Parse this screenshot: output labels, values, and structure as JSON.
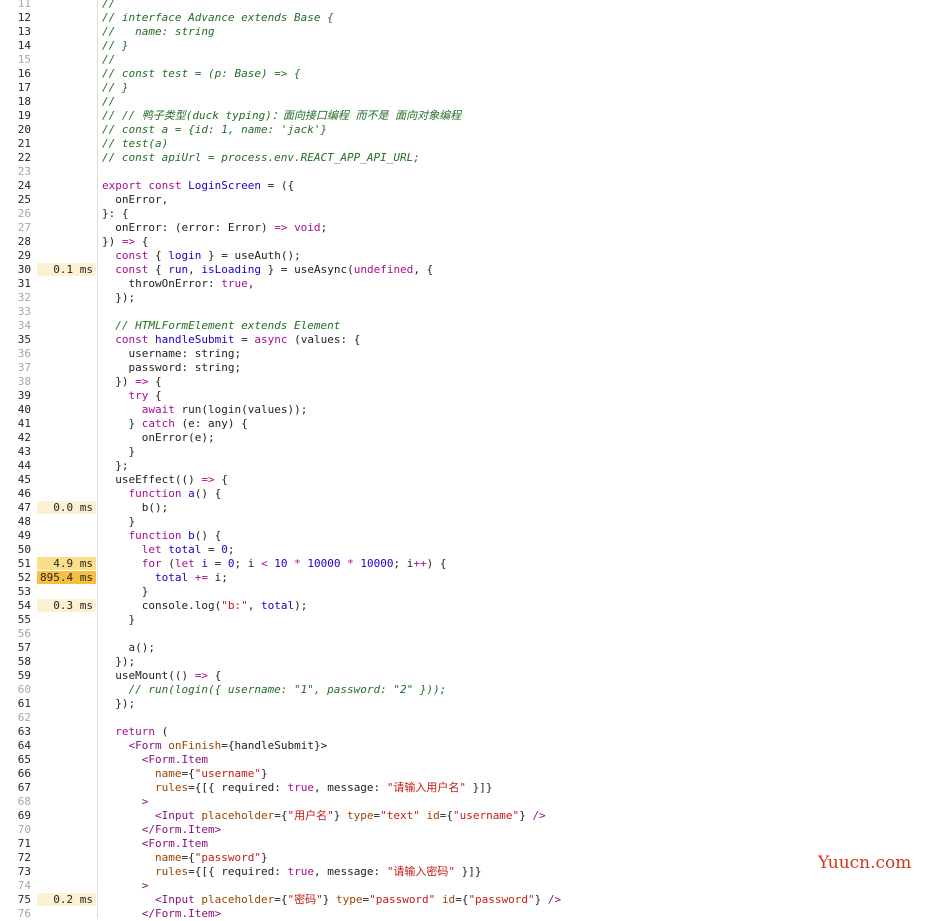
{
  "colors": {
    "heat_low": "#fdf1d4",
    "heat_mid": "#fcdd8c",
    "heat_high": "#f7bf3f",
    "gutter_line": "#dcdcdc"
  },
  "watermark": "Yuucn.com",
  "lines": [
    {
      "n": "11",
      "dim": true,
      "t": "",
      "tok": [
        [
          "//",
          "c"
        ]
      ]
    },
    {
      "n": "12",
      "t": "",
      "tok": [
        [
          "// interface Advance extends Base {",
          "c"
        ]
      ]
    },
    {
      "n": "13",
      "t": "",
      "tok": [
        [
          "//   name: string",
          "c"
        ]
      ]
    },
    {
      "n": "14",
      "t": "",
      "tok": [
        [
          "// }",
          "c"
        ]
      ]
    },
    {
      "n": "15",
      "dim": true,
      "t": "",
      "tok": [
        [
          "//",
          "c"
        ]
      ]
    },
    {
      "n": "16",
      "t": "",
      "tok": [
        [
          "// const test = (p: Base) => {",
          "c"
        ]
      ]
    },
    {
      "n": "17",
      "t": "",
      "tok": [
        [
          "// }",
          "c"
        ]
      ]
    },
    {
      "n": "18",
      "t": "",
      "tok": [
        [
          "//",
          "c"
        ]
      ]
    },
    {
      "n": "19",
      "t": "",
      "tok": [
        [
          "// // 鸭子类型(duck typing)：面向接口编程 而不是 面向对象编程",
          "c"
        ]
      ]
    },
    {
      "n": "20",
      "t": "",
      "tok": [
        [
          "// const a = {id: 1, name: 'jack'}",
          "c"
        ]
      ]
    },
    {
      "n": "21",
      "t": "",
      "tok": [
        [
          "// test(a)",
          "c"
        ]
      ]
    },
    {
      "n": "22",
      "t": "",
      "tok": [
        [
          "// const apiUrl = process.env.REACT_APP_API_URL;",
          "c"
        ]
      ]
    },
    {
      "n": "23",
      "dim": true,
      "t": "",
      "tok": []
    },
    {
      "n": "24",
      "t": "",
      "tok": [
        [
          "export const ",
          "k"
        ],
        [
          "LoginScreen",
          "f"
        ],
        [
          " = ({",
          "d"
        ]
      ]
    },
    {
      "n": "25",
      "t": "",
      "tok": [
        [
          "  onError,",
          "d"
        ]
      ]
    },
    {
      "n": "26",
      "dim": true,
      "t": "",
      "tok": [
        [
          "}: {",
          "d"
        ]
      ]
    },
    {
      "n": "27",
      "dim": true,
      "t": "",
      "tok": [
        [
          "  onError: (error: Error) ",
          "d"
        ],
        [
          "=>",
          "k"
        ],
        [
          " ",
          "d"
        ],
        [
          "void",
          "k"
        ],
        [
          ";",
          "d"
        ]
      ]
    },
    {
      "n": "28",
      "t": "",
      "tok": [
        [
          "}) ",
          "d"
        ],
        [
          "=>",
          "k"
        ],
        [
          " {",
          "d"
        ]
      ]
    },
    {
      "n": "29",
      "t": "",
      "tok": [
        [
          "  ",
          "d"
        ],
        [
          "const",
          "k"
        ],
        [
          " { ",
          "d"
        ],
        [
          "login",
          "f"
        ],
        [
          " } = useAuth();",
          "d"
        ]
      ]
    },
    {
      "n": "30",
      "t": "0.1ms",
      "h": "low",
      "tok": [
        [
          "  ",
          "d"
        ],
        [
          "const",
          "k"
        ],
        [
          " { ",
          "d"
        ],
        [
          "run",
          "f"
        ],
        [
          ", ",
          "d"
        ],
        [
          "isLoading",
          "f"
        ],
        [
          " } = useAsync(",
          "d"
        ],
        [
          "undefined",
          "k"
        ],
        [
          ", {",
          "d"
        ]
      ]
    },
    {
      "n": "31",
      "t": "",
      "tok": [
        [
          "    throwOnError: ",
          "d"
        ],
        [
          "true",
          "k"
        ],
        [
          ",",
          "d"
        ]
      ]
    },
    {
      "n": "32",
      "dim": true,
      "t": "",
      "tok": [
        [
          "  });",
          "d"
        ]
      ]
    },
    {
      "n": "33",
      "dim": true,
      "t": "",
      "tok": []
    },
    {
      "n": "34",
      "dim": true,
      "t": "",
      "tok": [
        [
          "  // HTMLFormElement extends Element",
          "c"
        ]
      ]
    },
    {
      "n": "35",
      "t": "",
      "tok": [
        [
          "  ",
          "d"
        ],
        [
          "const",
          "k"
        ],
        [
          " ",
          "d"
        ],
        [
          "handleSubmit",
          "f"
        ],
        [
          " = ",
          "d"
        ],
        [
          "async",
          "k"
        ],
        [
          " (values: {",
          "d"
        ]
      ]
    },
    {
      "n": "36",
      "dim": true,
      "t": "",
      "tok": [
        [
          "    username: string;",
          "d"
        ]
      ]
    },
    {
      "n": "37",
      "dim": true,
      "t": "",
      "tok": [
        [
          "    password: string;",
          "d"
        ]
      ]
    },
    {
      "n": "38",
      "dim": true,
      "t": "",
      "tok": [
        [
          "  }) ",
          "d"
        ],
        [
          "=>",
          "k"
        ],
        [
          " {",
          "d"
        ]
      ]
    },
    {
      "n": "39",
      "t": "",
      "tok": [
        [
          "    ",
          "d"
        ],
        [
          "try",
          "k"
        ],
        [
          " {",
          "d"
        ]
      ]
    },
    {
      "n": "40",
      "t": "",
      "tok": [
        [
          "      ",
          "d"
        ],
        [
          "await",
          "k"
        ],
        [
          " run(login(values));",
          "d"
        ]
      ]
    },
    {
      "n": "41",
      "t": "",
      "tok": [
        [
          "    } ",
          "d"
        ],
        [
          "catch",
          "k"
        ],
        [
          " (e: any) {",
          "d"
        ]
      ]
    },
    {
      "n": "42",
      "t": "",
      "tok": [
        [
          "      onError(e);",
          "d"
        ]
      ]
    },
    {
      "n": "43",
      "t": "",
      "tok": [
        [
          "    }",
          "d"
        ]
      ]
    },
    {
      "n": "44",
      "t": "",
      "tok": [
        [
          "  };",
          "d"
        ]
      ]
    },
    {
      "n": "45",
      "t": "",
      "tok": [
        [
          "  useEffect(() ",
          "d"
        ],
        [
          "=>",
          "k"
        ],
        [
          " {",
          "d"
        ]
      ]
    },
    {
      "n": "46",
      "t": "",
      "tok": [
        [
          "    ",
          "d"
        ],
        [
          "function",
          "k"
        ],
        [
          " ",
          "d"
        ],
        [
          "a",
          "f"
        ],
        [
          "() {",
          "d"
        ]
      ]
    },
    {
      "n": "47",
      "t": "0.0ms",
      "h": "low",
      "tok": [
        [
          "      b();",
          "d"
        ]
      ]
    },
    {
      "n": "48",
      "t": "",
      "tok": [
        [
          "    }",
          "d"
        ]
      ]
    },
    {
      "n": "49",
      "t": "",
      "tok": [
        [
          "    ",
          "d"
        ],
        [
          "function",
          "k"
        ],
        [
          " ",
          "d"
        ],
        [
          "b",
          "f"
        ],
        [
          "() {",
          "d"
        ]
      ]
    },
    {
      "n": "50",
      "t": "",
      "tok": [
        [
          "      ",
          "d"
        ],
        [
          "let",
          "k"
        ],
        [
          " ",
          "d"
        ],
        [
          "total",
          "f"
        ],
        [
          " = ",
          "d"
        ],
        [
          "0",
          "n"
        ],
        [
          ";",
          "d"
        ]
      ]
    },
    {
      "n": "51",
      "t": "4.9ms",
      "h": "mid",
      "tok": [
        [
          "      ",
          "d"
        ],
        [
          "for",
          "k"
        ],
        [
          " (",
          "d"
        ],
        [
          "let",
          "k"
        ],
        [
          " ",
          "d"
        ],
        [
          "i",
          "f"
        ],
        [
          " = ",
          "d"
        ],
        [
          "0",
          "n"
        ],
        [
          "; i ",
          "d"
        ],
        [
          "<",
          "k"
        ],
        [
          " ",
          "d"
        ],
        [
          "10",
          "n"
        ],
        [
          " ",
          "d"
        ],
        [
          "*",
          "k"
        ],
        [
          " ",
          "d"
        ],
        [
          "10000",
          "n"
        ],
        [
          " ",
          "d"
        ],
        [
          "*",
          "k"
        ],
        [
          " ",
          "d"
        ],
        [
          "10000",
          "n"
        ],
        [
          "; i",
          "d"
        ],
        [
          "++",
          "k"
        ],
        [
          ") {",
          "d"
        ]
      ]
    },
    {
      "n": "52",
      "t": "895.4ms",
      "h": "high",
      "tok": [
        [
          "        ",
          "d"
        ],
        [
          "total",
          "f"
        ],
        [
          " ",
          "d"
        ],
        [
          "+=",
          "k"
        ],
        [
          " i;",
          "d"
        ]
      ]
    },
    {
      "n": "53",
      "t": "",
      "tok": [
        [
          "      }",
          "d"
        ]
      ]
    },
    {
      "n": "54",
      "t": "0.3ms",
      "h": "low",
      "tok": [
        [
          "      console.log(",
          "d"
        ],
        [
          "\"b:\"",
          "s"
        ],
        [
          ", ",
          "d"
        ],
        [
          "total",
          "f"
        ],
        [
          ");",
          "d"
        ]
      ]
    },
    {
      "n": "55",
      "t": "",
      "tok": [
        [
          "    }",
          "d"
        ]
      ]
    },
    {
      "n": "56",
      "dim": true,
      "t": "",
      "tok": []
    },
    {
      "n": "57",
      "t": "",
      "tok": [
        [
          "    a();",
          "d"
        ]
      ]
    },
    {
      "n": "58",
      "t": "",
      "tok": [
        [
          "  });",
          "d"
        ]
      ]
    },
    {
      "n": "59",
      "t": "",
      "tok": [
        [
          "  useMount(() ",
          "d"
        ],
        [
          "=>",
          "k"
        ],
        [
          " {",
          "d"
        ]
      ]
    },
    {
      "n": "60",
      "dim": true,
      "t": "",
      "tok": [
        [
          "    // run(login({ username: \"1\", password: \"2\" }));",
          "c"
        ]
      ]
    },
    {
      "n": "61",
      "t": "",
      "tok": [
        [
          "  });",
          "d"
        ]
      ]
    },
    {
      "n": "62",
      "dim": true,
      "t": "",
      "tok": []
    },
    {
      "n": "63",
      "t": "",
      "tok": [
        [
          "  ",
          "d"
        ],
        [
          "return",
          "k"
        ],
        [
          " (",
          "d"
        ]
      ]
    },
    {
      "n": "64",
      "t": "",
      "tok": [
        [
          "    <",
          "t"
        ],
        [
          "Form",
          "t"
        ],
        [
          " ",
          "d"
        ],
        [
          "onFinish",
          "a"
        ],
        [
          "={handleSubmit}>",
          "d"
        ]
      ]
    },
    {
      "n": "65",
      "t": "",
      "tok": [
        [
          "      <Form.Item",
          "t"
        ]
      ]
    },
    {
      "n": "66",
      "t": "",
      "tok": [
        [
          "        ",
          "d"
        ],
        [
          "name",
          "a"
        ],
        [
          "={",
          "d"
        ],
        [
          "\"username\"",
          "s"
        ],
        [
          "}",
          "d"
        ]
      ]
    },
    {
      "n": "67",
      "t": "",
      "tok": [
        [
          "        ",
          "d"
        ],
        [
          "rules",
          "a"
        ],
        [
          "={[{ required: ",
          "d"
        ],
        [
          "true",
          "k"
        ],
        [
          ", message: ",
          "d"
        ],
        [
          "\"请输入用户名\"",
          "s"
        ],
        [
          " }]}",
          "d"
        ]
      ]
    },
    {
      "n": "68",
      "dim": true,
      "t": "",
      "tok": [
        [
          "      >",
          "t"
        ]
      ]
    },
    {
      "n": "69",
      "t": "",
      "tok": [
        [
          "        <Input ",
          "t"
        ],
        [
          "placeholder",
          "a"
        ],
        [
          "={",
          "d"
        ],
        [
          "\"用户名\"",
          "s"
        ],
        [
          "} ",
          "d"
        ],
        [
          "type",
          "a"
        ],
        [
          "=",
          "d"
        ],
        [
          "\"text\"",
          "s"
        ],
        [
          " ",
          "d"
        ],
        [
          "id",
          "a"
        ],
        [
          "={",
          "d"
        ],
        [
          "\"username\"",
          "s"
        ],
        [
          "} ",
          "d"
        ],
        [
          "/>",
          "t"
        ]
      ]
    },
    {
      "n": "70",
      "dim": true,
      "t": "",
      "tok": [
        [
          "      </Form.Item>",
          "t"
        ]
      ]
    },
    {
      "n": "71",
      "t": "",
      "tok": [
        [
          "      <Form.Item",
          "t"
        ]
      ]
    },
    {
      "n": "72",
      "t": "",
      "tok": [
        [
          "        ",
          "d"
        ],
        [
          "name",
          "a"
        ],
        [
          "={",
          "d"
        ],
        [
          "\"password\"",
          "s"
        ],
        [
          "}",
          "d"
        ]
      ]
    },
    {
      "n": "73",
      "t": "",
      "tok": [
        [
          "        ",
          "d"
        ],
        [
          "rules",
          "a"
        ],
        [
          "={[{ required: ",
          "d"
        ],
        [
          "true",
          "k"
        ],
        [
          ", message: ",
          "d"
        ],
        [
          "\"请输入密码\"",
          "s"
        ],
        [
          " }]}",
          "d"
        ]
      ]
    },
    {
      "n": "74",
      "dim": true,
      "t": "",
      "tok": [
        [
          "      >",
          "t"
        ]
      ]
    },
    {
      "n": "75",
      "t": "0.2ms",
      "h": "low",
      "tok": [
        [
          "        <Input ",
          "t"
        ],
        [
          "placeholder",
          "a"
        ],
        [
          "={",
          "d"
        ],
        [
          "\"密码\"",
          "s"
        ],
        [
          "} ",
          "d"
        ],
        [
          "type",
          "a"
        ],
        [
          "=",
          "d"
        ],
        [
          "\"password\"",
          "s"
        ],
        [
          " ",
          "d"
        ],
        [
          "id",
          "a"
        ],
        [
          "={",
          "d"
        ],
        [
          "\"password\"",
          "s"
        ],
        [
          "} ",
          "d"
        ],
        [
          "/>",
          "t"
        ]
      ]
    },
    {
      "n": "76",
      "dim": true,
      "t": "",
      "tok": [
        [
          "      </Form.Item>",
          "t"
        ]
      ]
    }
  ]
}
